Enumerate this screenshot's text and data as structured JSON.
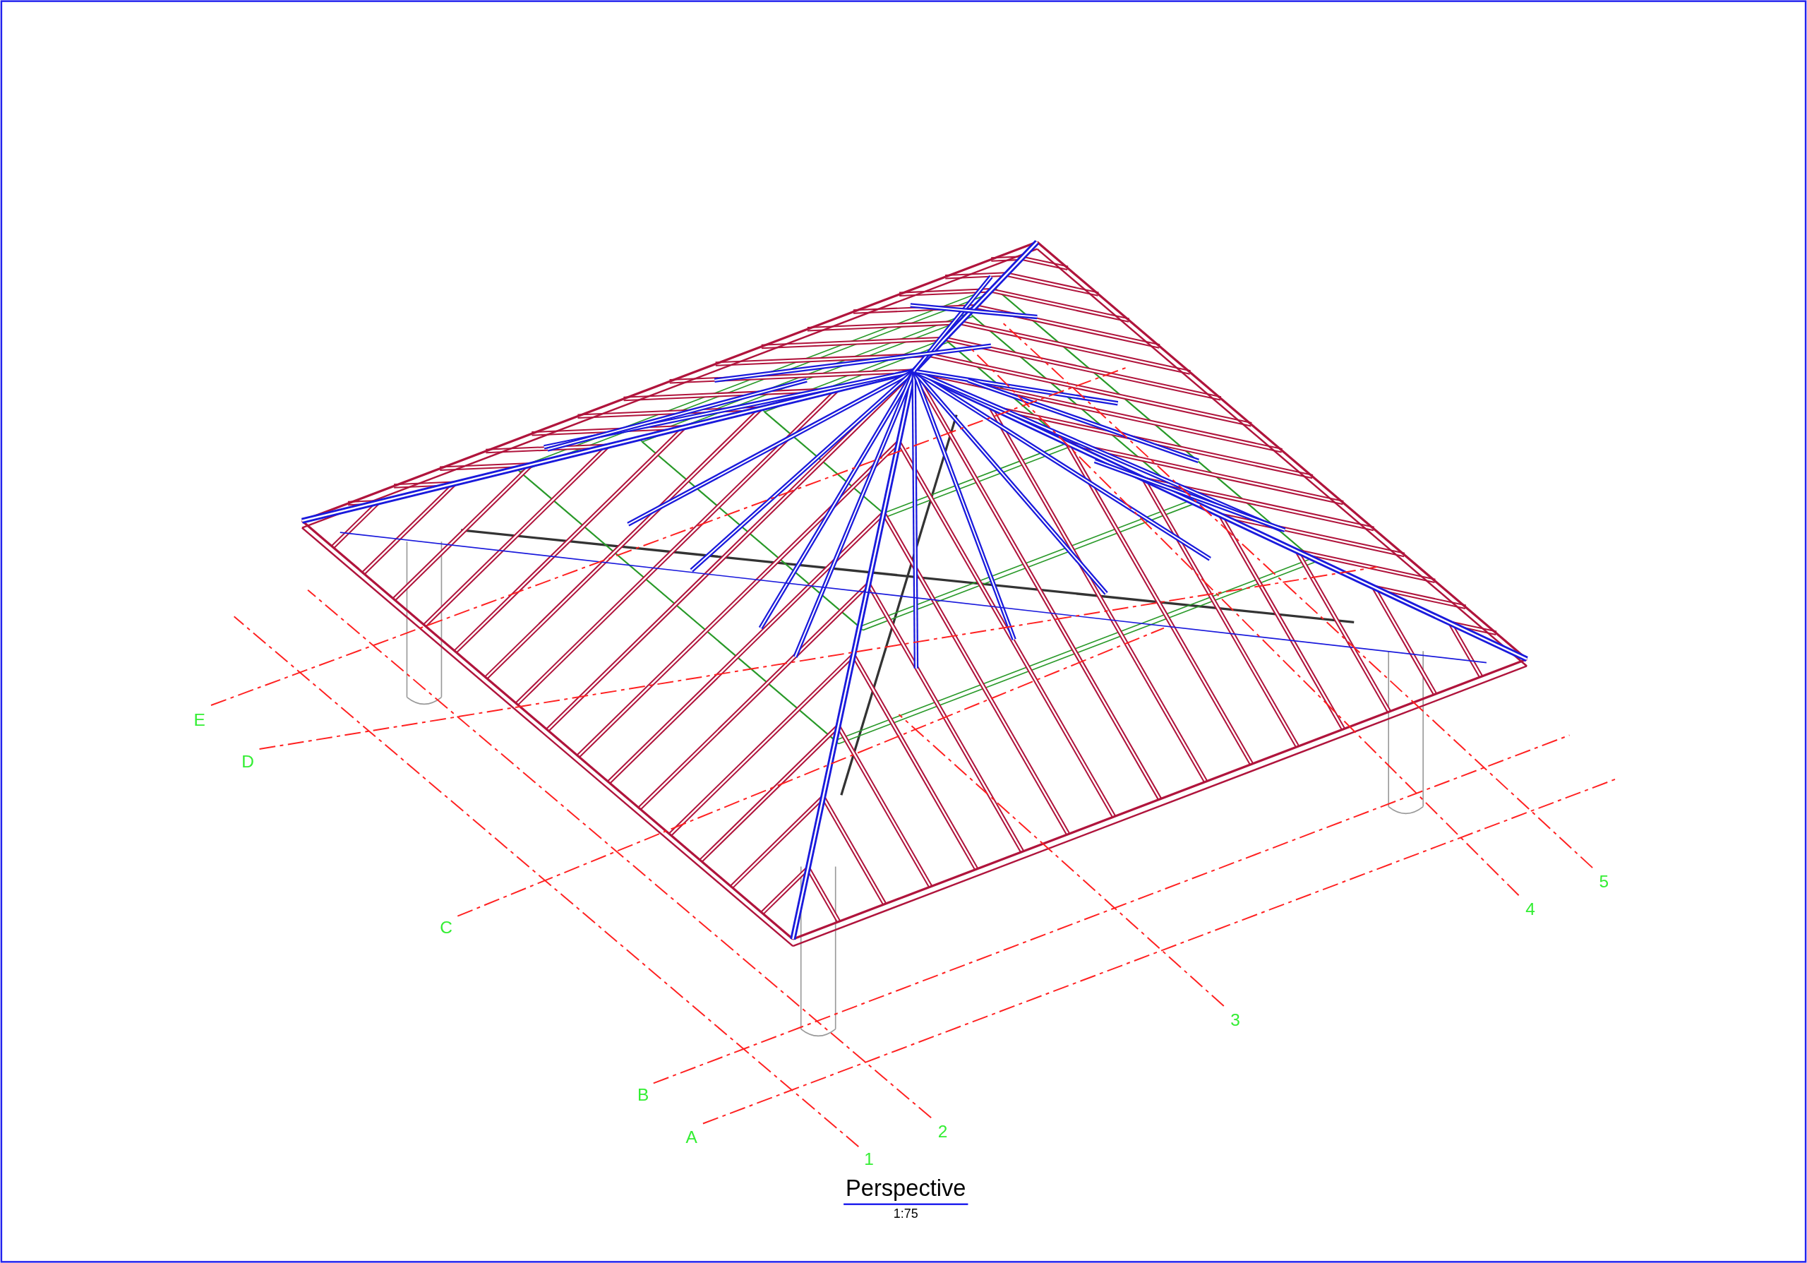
{
  "view": {
    "title": "Perspective",
    "scale": "1:75"
  },
  "grids": [
    {
      "label": "E"
    },
    {
      "label": "D"
    },
    {
      "label": "C"
    },
    {
      "label": "B"
    },
    {
      "label": "A"
    },
    {
      "label": "1"
    },
    {
      "label": "2"
    },
    {
      "label": "3"
    },
    {
      "label": "4"
    },
    {
      "label": "5"
    }
  ]
}
